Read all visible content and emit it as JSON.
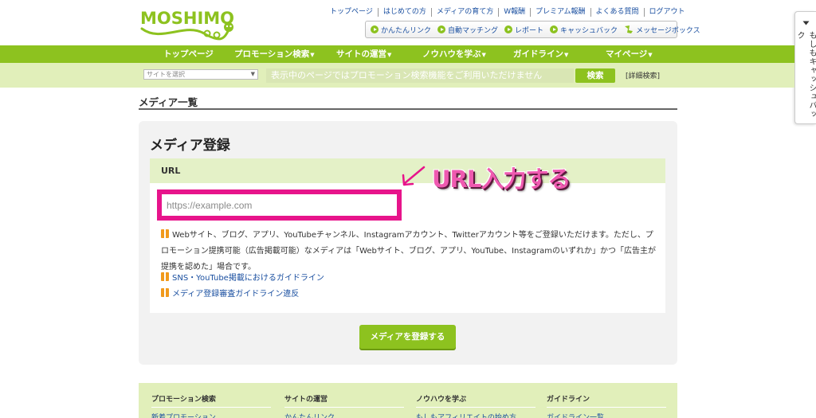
{
  "brand": {
    "logo_text": "MOSHIMO",
    "accent": "#8dc21f",
    "highlight": "#e7148b"
  },
  "top_links": [
    "トップページ",
    "はじめての方",
    "メディアの育て方",
    "W報酬",
    "プレミアム報酬",
    "よくある質問",
    "ログアウト"
  ],
  "quick_links": [
    {
      "label": "かんたんリンク",
      "icon": "play-icon"
    },
    {
      "label": "自動マッチング",
      "icon": "play-icon"
    },
    {
      "label": "レポート",
      "icon": "play-icon"
    },
    {
      "label": "キャッシュバック",
      "icon": "play-icon"
    },
    {
      "label": "メッセージボックス",
      "icon": "message-box-icon"
    }
  ],
  "side_tab": {
    "label": "もしもキャッシュバック",
    "icon": "triangle-down-icon"
  },
  "nav": [
    {
      "label": "トップページ",
      "dropdown": false
    },
    {
      "label": "プロモーション検索",
      "dropdown": true
    },
    {
      "label": "サイトの運営",
      "dropdown": true
    },
    {
      "label": "ノウハウを学ぶ",
      "dropdown": true
    },
    {
      "label": "ガイドライン",
      "dropdown": true
    },
    {
      "label": "マイページ",
      "dropdown": true
    }
  ],
  "search": {
    "site_select": "サイトを選択",
    "placeholder": "表示中のページではプロモーション検索機能をご利用いただけません",
    "button": "検索",
    "detail_link": "[詳細検索]"
  },
  "page_title": "メディア一覧",
  "card": {
    "title": "メディア登録",
    "section_label": "URL",
    "url_placeholder": "https://example.com",
    "url_value": "",
    "note": "Webサイト、ブログ、アプリ、YouTubeチャンネル、Instagramアカウント、Twitterアカウント等をご登録いただけます。ただし、プロモーション提携可能（広告掲載可能）なメディアは「Webサイト、ブログ、アプリ、YouTube、Instagramのいずれか」かつ「広告主が提携を認めた」場合です。",
    "links": [
      "SNS・YouTube掲載におけるガイドライン",
      "メディア登録審査ガイドライン違反"
    ],
    "submit": "メディアを登録する"
  },
  "annotation": {
    "text": "URL入力する",
    "arrow": "↙"
  },
  "footer": [
    {
      "head": "プロモーション検索",
      "item": "新着プロモーション"
    },
    {
      "head": "サイトの運営",
      "item": "かんたんリンク"
    },
    {
      "head": "ノウハウを学ぶ",
      "item": "もしもアフィリエイトの始め方"
    },
    {
      "head": "ガイドライン",
      "item": "ガイドライン一覧"
    }
  ]
}
